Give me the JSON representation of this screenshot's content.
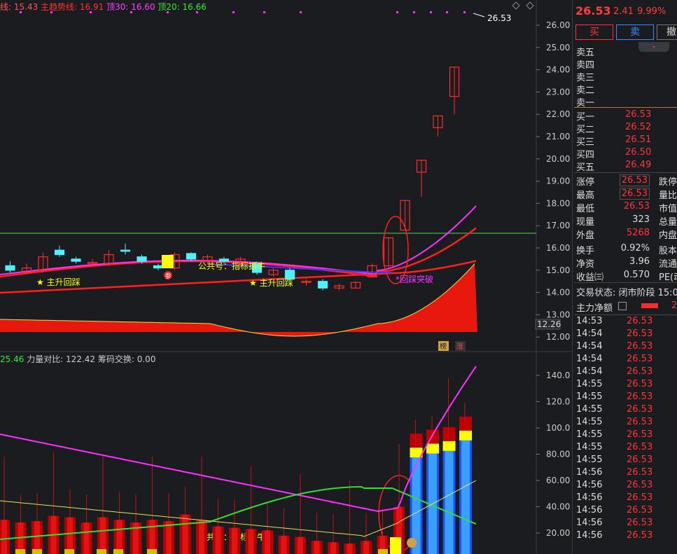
{
  "legend": {
    "item1": "线: 15.43",
    "item2": "主趋势线: 16.91",
    "item3": "顶30: 16.60",
    "item4": "顶20: 16.66"
  },
  "legend_lower": {
    "item1": "25.46",
    "item2": "力量对比: 122.42",
    "item3": "筹码交换: 0.00"
  },
  "annotations": {
    "main_up_1": "★ 主升回踩",
    "main_up_2": "★ 主升回踩",
    "breakout": "*回踩突破",
    "public1": "公共号：指标抓牛",
    "public2": "公共号：指标抓牛",
    "last_price_marker": "26.53",
    "low_marker": "12.26",
    "badge_bang": "榜",
    "badge_zhang": "涨",
    "badge_can": "参"
  },
  "colors": {
    "up": "#ff2a2a",
    "down": "#4ff0ff",
    "magenta": "#ff30ff",
    "green": "#33dd33",
    "yellow": "#ffff00",
    "blue": "#2266ff",
    "bg": "#1b1c20"
  },
  "price_axis_labels": [
    "26.00",
    "25.00",
    "24.00",
    "23.00",
    "22.00",
    "21.00",
    "20.00",
    "19.00",
    "18.00",
    "17.00",
    "16.00",
    "15.00",
    "14.00",
    "13.00",
    "12.00"
  ],
  "lower_axis_labels": [
    "140.0",
    "120.0",
    "100.0",
    "80.00",
    "60.00",
    "40.00",
    "20.00"
  ],
  "quote": {
    "price": "26.53",
    "change": "2.41",
    "pct": "9.99%",
    "buy_btn": "买",
    "sell_btn": "卖",
    "cancel_btn": "撤"
  },
  "order_book": {
    "asks": [
      "卖五",
      "卖四",
      "卖三",
      "卖二",
      "卖一"
    ],
    "bids": [
      {
        "label": "买一",
        "price": "26.53"
      },
      {
        "label": "买二",
        "price": "26.52"
      },
      {
        "label": "买三",
        "price": "26.51"
      },
      {
        "label": "买四",
        "price": "26.50"
      },
      {
        "label": "买五",
        "price": "26.49"
      }
    ]
  },
  "stats": {
    "limit_up_label": "涨停",
    "limit_up": "26.53",
    "limit_down_label": "跌停",
    "high_label": "最高",
    "high": "26.53",
    "vol_ratio_label": "量比",
    "low_label": "最低",
    "low": "26.53",
    "mktcap_label": "市值",
    "now_vol_label": "现量",
    "now_vol": "323",
    "total_label": "总量",
    "outer_label": "外盘",
    "outer": "5268",
    "inner_label": "内盘",
    "turnover_label": "换手",
    "turnover": "0.92%",
    "capital_label": "股本",
    "nav_label": "净资",
    "nav": "3.96",
    "float_label": "流通",
    "eps_label": "收益㈢",
    "eps": "0.570",
    "pe_label": "PE(动"
  },
  "status": {
    "trade_status": "交易状态: 闭市阶段 15:0",
    "main_flow_label": "主力净额",
    "main_flow_val": "2"
  },
  "ticks": [
    {
      "t": "14:53",
      "p": "26.53"
    },
    {
      "t": "14:54",
      "p": "26.53"
    },
    {
      "t": "14:54",
      "p": "26.53"
    },
    {
      "t": "14:54",
      "p": "26.53"
    },
    {
      "t": "14:54",
      "p": "26.53"
    },
    {
      "t": "14:55",
      "p": "26.53"
    },
    {
      "t": "14:55",
      "p": "26.53"
    },
    {
      "t": "14:55",
      "p": "26.53"
    },
    {
      "t": "14:55",
      "p": "26.53"
    },
    {
      "t": "14:55",
      "p": "26.53"
    },
    {
      "t": "14:55",
      "p": "26.53"
    },
    {
      "t": "14:55",
      "p": "26.53"
    },
    {
      "t": "14:56",
      "p": "26.53"
    },
    {
      "t": "14:56",
      "p": "26.53"
    },
    {
      "t": "14:56",
      "p": "26.53"
    },
    {
      "t": "14:56",
      "p": "26.53"
    },
    {
      "t": "14:56",
      "p": "26.53"
    },
    {
      "t": "14:56",
      "p": "26.53"
    }
  ],
  "chart_data": {
    "type": "candlestick",
    "candles": [
      {
        "o": 15.2,
        "c": 15.0,
        "h": 15.4,
        "l": 14.9
      },
      {
        "o": 14.9,
        "c": 15.1,
        "h": 15.3,
        "l": 14.8
      },
      {
        "o": 15.0,
        "c": 15.6,
        "h": 15.8,
        "l": 14.9
      },
      {
        "o": 15.9,
        "c": 15.7,
        "h": 16.1,
        "l": 15.6
      },
      {
        "o": 15.5,
        "c": 15.4,
        "h": 15.6,
        "l": 15.3
      },
      {
        "o": 15.3,
        "c": 15.35,
        "h": 15.5,
        "l": 15.2
      },
      {
        "o": 15.3,
        "c": 15.7,
        "h": 15.9,
        "l": 15.2
      },
      {
        "o": 15.9,
        "c": 15.85,
        "h": 16.2,
        "l": 15.7
      },
      {
        "o": 15.6,
        "c": 15.4,
        "h": 15.7,
        "l": 15.3
      },
      {
        "o": 15.2,
        "c": 15.1,
        "h": 15.3,
        "l": 15.0
      },
      {
        "o": 15.1,
        "c": 15.7,
        "h": 15.8,
        "l": 15.0
      },
      {
        "o": 15.75,
        "c": 15.5,
        "h": 15.8,
        "l": 15.4
      },
      {
        "o": 15.4,
        "c": 15.6,
        "h": 15.7,
        "l": 15.3
      },
      {
        "o": 15.5,
        "c": 15.4,
        "h": 15.6,
        "l": 15.3
      },
      {
        "o": 15.3,
        "c": 15.5,
        "h": 15.6,
        "l": 15.2
      },
      {
        "o": 15.3,
        "c": 14.9,
        "h": 15.4,
        "l": 14.8
      },
      {
        "o": 14.8,
        "c": 15.0,
        "h": 15.1,
        "l": 14.7
      },
      {
        "o": 15.0,
        "c": 14.6,
        "h": 15.1,
        "l": 14.5
      },
      {
        "o": 14.5,
        "c": 14.5,
        "h": 14.6,
        "l": 14.3
      },
      {
        "o": 14.5,
        "c": 14.2,
        "h": 14.6,
        "l": 14.1
      },
      {
        "o": 14.2,
        "c": 14.3,
        "h": 14.4,
        "l": 14.1
      },
      {
        "o": 14.2,
        "c": 14.45,
        "h": 14.5,
        "l": 14.2
      },
      {
        "o": 14.7,
        "c": 15.2,
        "h": 15.3,
        "l": 14.7
      },
      {
        "o": 15.2,
        "c": 16.45,
        "h": 16.5,
        "l": 15.1
      },
      {
        "o": 16.8,
        "c": 18.13,
        "h": 18.13,
        "l": 16.8
      },
      {
        "o": 19.4,
        "c": 19.94,
        "h": 19.94,
        "l": 18.3
      },
      {
        "o": 21.4,
        "c": 21.93,
        "h": 21.93,
        "l": 21.0
      },
      {
        "o": 22.8,
        "c": 24.12,
        "h": 24.12,
        "l": 22.0
      }
    ],
    "last_price": 26.53,
    "y_range": [
      11.8,
      26.5
    ],
    "volume": [
      30,
      28,
      29,
      33,
      32,
      28,
      32,
      30,
      28,
      30,
      29,
      34,
      30,
      25,
      24,
      23,
      22,
      18,
      17,
      14,
      13,
      12,
      14,
      18,
      40,
      85,
      88,
      90,
      98
    ],
    "lower_range": [
      0,
      150
    ]
  }
}
